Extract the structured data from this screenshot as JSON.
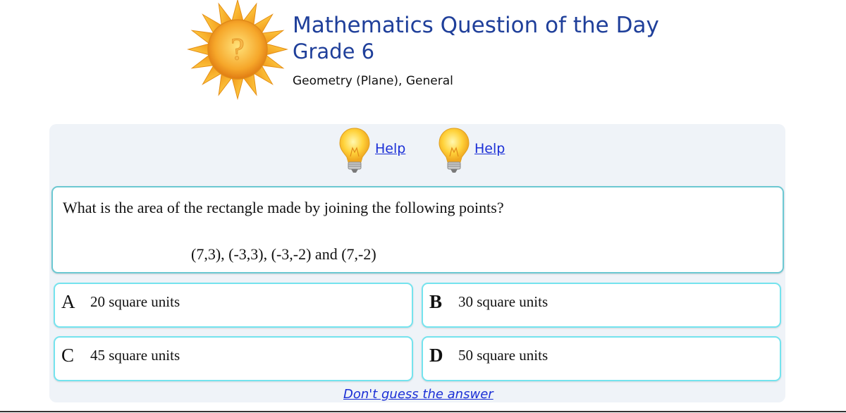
{
  "header": {
    "title": "Mathematics Question of the Day",
    "grade": "Grade 6",
    "topic": "Geometry (Plane), General"
  },
  "help_links": [
    {
      "label": "Help",
      "icon": "lightbulb-icon"
    },
    {
      "label": "Help",
      "icon": "lightbulb-icon"
    }
  ],
  "question": {
    "text": "What is the area of the rectangle made by joining the following points?",
    "points": "(7,3), (-3,3), (-3,-2) and (7,-2)"
  },
  "choices": [
    {
      "letter": "A",
      "text": "20 square units"
    },
    {
      "letter": "B",
      "text": "30 square units"
    },
    {
      "letter": "C",
      "text": "45 square units"
    },
    {
      "letter": "D",
      "text": "50 square units"
    }
  ],
  "footer_link": "Don't guess the answer",
  "colors": {
    "title": "#1f3f9a",
    "panel_bg": "#eff3f8",
    "question_border": "#6cc8d2",
    "choice_border": "#74e3ee",
    "link": "#1b2fd6"
  }
}
